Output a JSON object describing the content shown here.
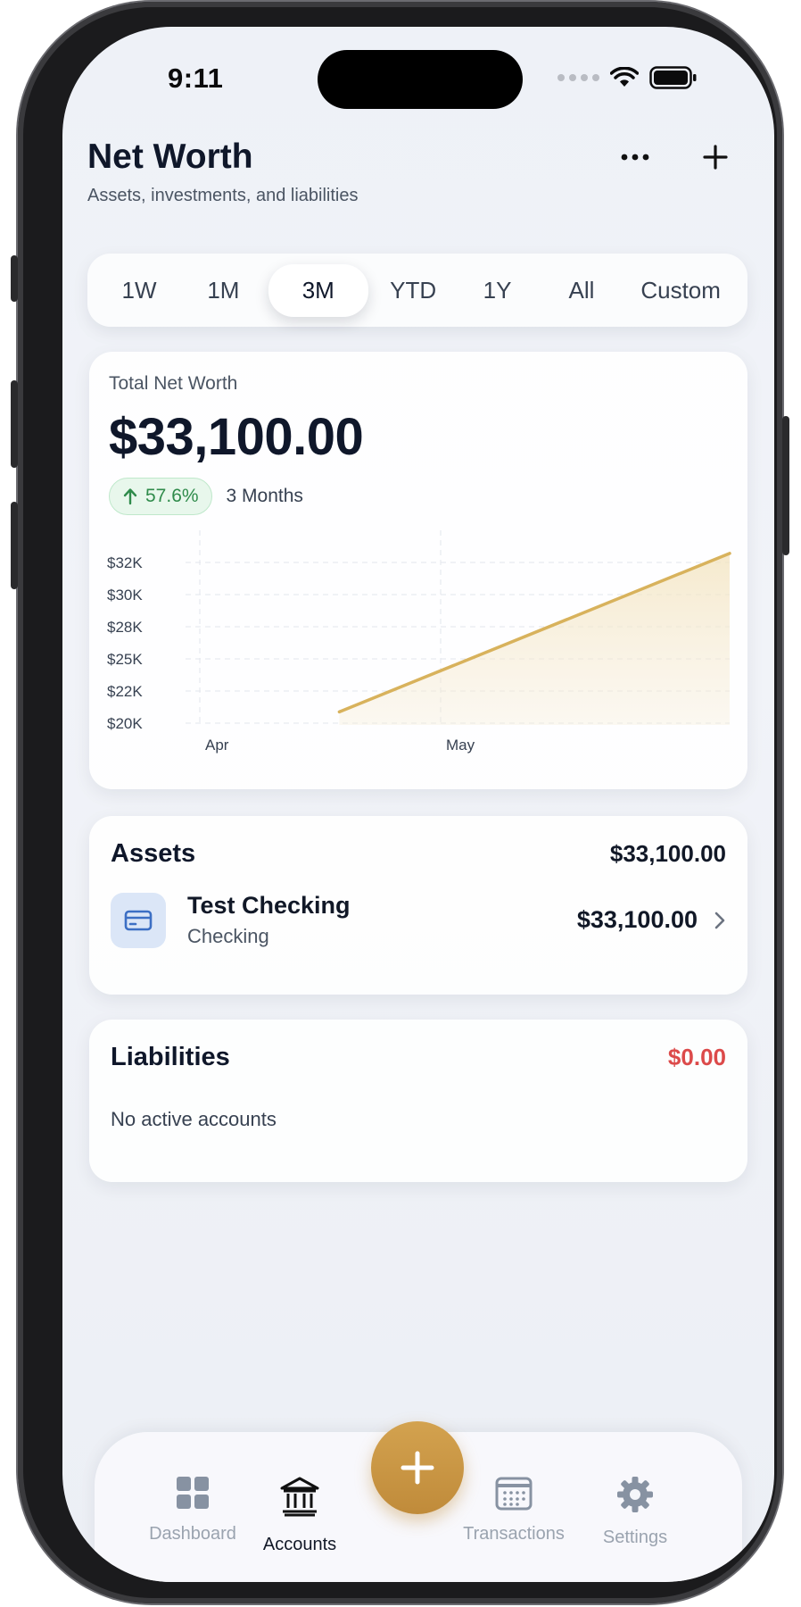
{
  "status": {
    "time": "9:11"
  },
  "header": {
    "title": "Net Worth",
    "subtitle": "Assets, investments, and liabilities",
    "more_icon": "ellipsis-icon",
    "add_icon": "plus-icon"
  },
  "range_tabs": [
    {
      "label": "1W"
    },
    {
      "label": "1M"
    },
    {
      "label": "3M",
      "active": true
    },
    {
      "label": "YTD"
    },
    {
      "label": "1Y"
    },
    {
      "label": "All"
    },
    {
      "label": "Custom"
    }
  ],
  "net_worth": {
    "label": "Total Net Worth",
    "value": "$33,100.00",
    "change": "57.6%",
    "change_direction": "up",
    "period": "3 Months"
  },
  "chart_data": {
    "type": "area",
    "y_ticks": [
      "$32K",
      "$30K",
      "$28K",
      "$25K",
      "$22K",
      "$20K"
    ],
    "x_ticks": [
      "Apr",
      "May"
    ],
    "series": [
      {
        "points": [
          {
            "x": "2025-04-15",
            "y": 21000
          },
          {
            "x": "2025-06-20",
            "y": 33100
          }
        ]
      }
    ],
    "ylim": [
      20000,
      33500
    ],
    "xlim": [
      "2025-03-20",
      "2025-06-20"
    ],
    "grid": true,
    "line_color": "#d8b25c"
  },
  "assets": {
    "title": "Assets",
    "total": "$33,100.00",
    "accounts": [
      {
        "name": "Test Checking",
        "type": "Checking",
        "balance": "$33,100.00",
        "icon": "credit-card-icon"
      }
    ]
  },
  "liabilities": {
    "title": "Liabilities",
    "total": "$0.00",
    "total_color": "#dc4a4a",
    "empty_text": "No active accounts"
  },
  "tabbar": {
    "items": [
      {
        "label": "Dashboard",
        "icon": "grid-icon"
      },
      {
        "label": "Accounts",
        "icon": "bank-icon",
        "active": true
      },
      {
        "label": "Transactions",
        "icon": "calendar-icon"
      },
      {
        "label": "Settings",
        "icon": "gear-icon"
      }
    ],
    "fab_icon": "plus-icon",
    "accent": "#c9963f"
  }
}
